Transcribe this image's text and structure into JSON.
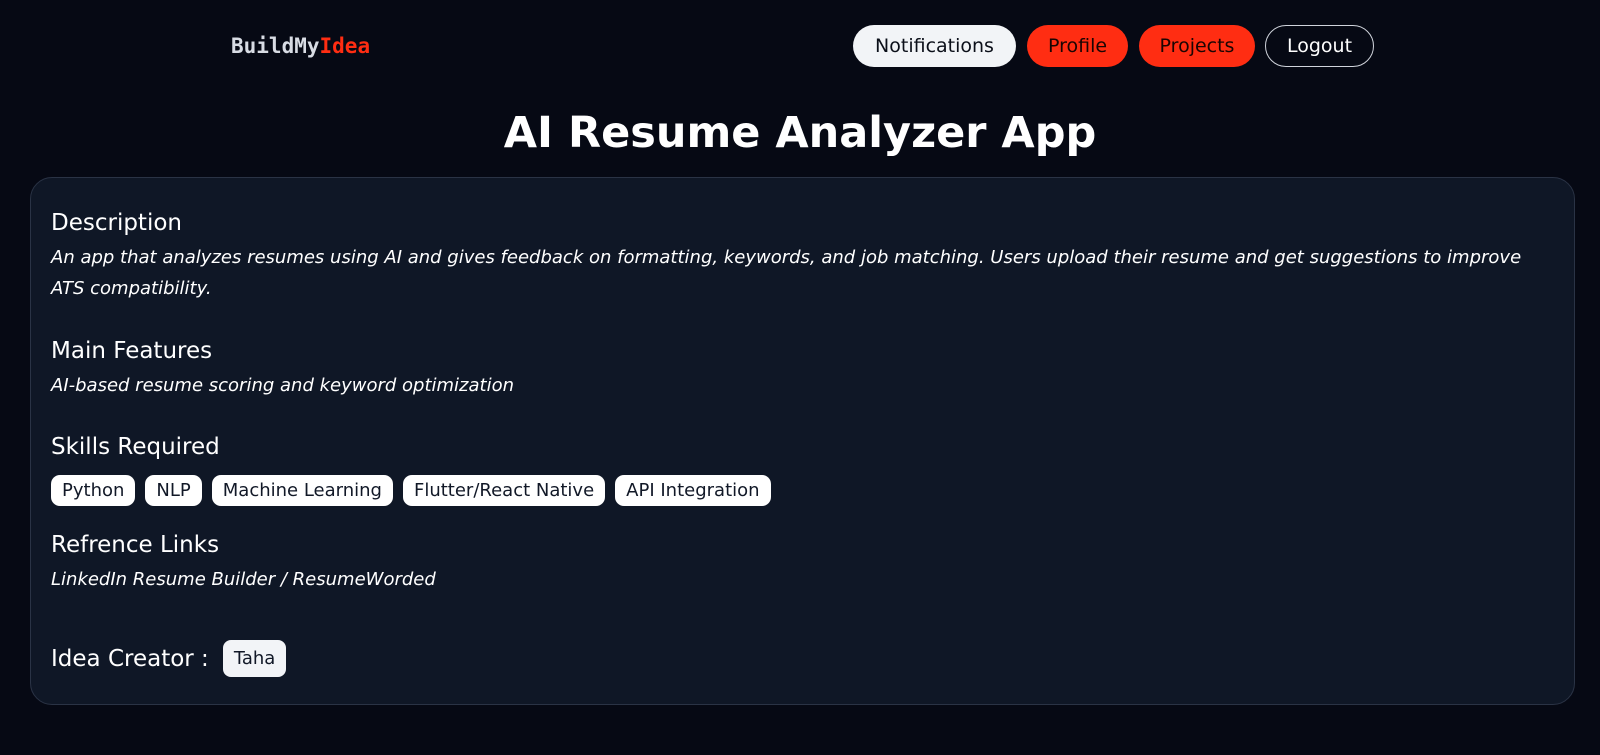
{
  "header": {
    "logo_part1": "BuildMy",
    "logo_part2": "Idea",
    "nav": {
      "notifications": "Notifications",
      "profile": "Profile",
      "projects": "Projects",
      "logout": "Logout"
    }
  },
  "page_title": "AI Resume Analyzer App",
  "card": {
    "description_title": "Description",
    "description_text": "An app that analyzes resumes using AI and gives feedback on formatting, keywords, and job matching. Users upload their resume and get suggestions to improve ATS compatibility.",
    "features_title": "Main Features",
    "features_text": "AI-based resume scoring and keyword optimization",
    "skills_title": "Skills Required",
    "skills": [
      "Python",
      "NLP",
      "Machine Learning",
      "Flutter/React Native",
      "API Integration"
    ],
    "links_title": "Refrence Links",
    "links_text": "LinkedIn Resume Builder / ResumeWorded",
    "creator_label": "Idea Creator :",
    "creator_name": "Taha"
  },
  "colors": {
    "background": "#060914",
    "card": "#0f1726",
    "accent": "#ff2d12"
  }
}
